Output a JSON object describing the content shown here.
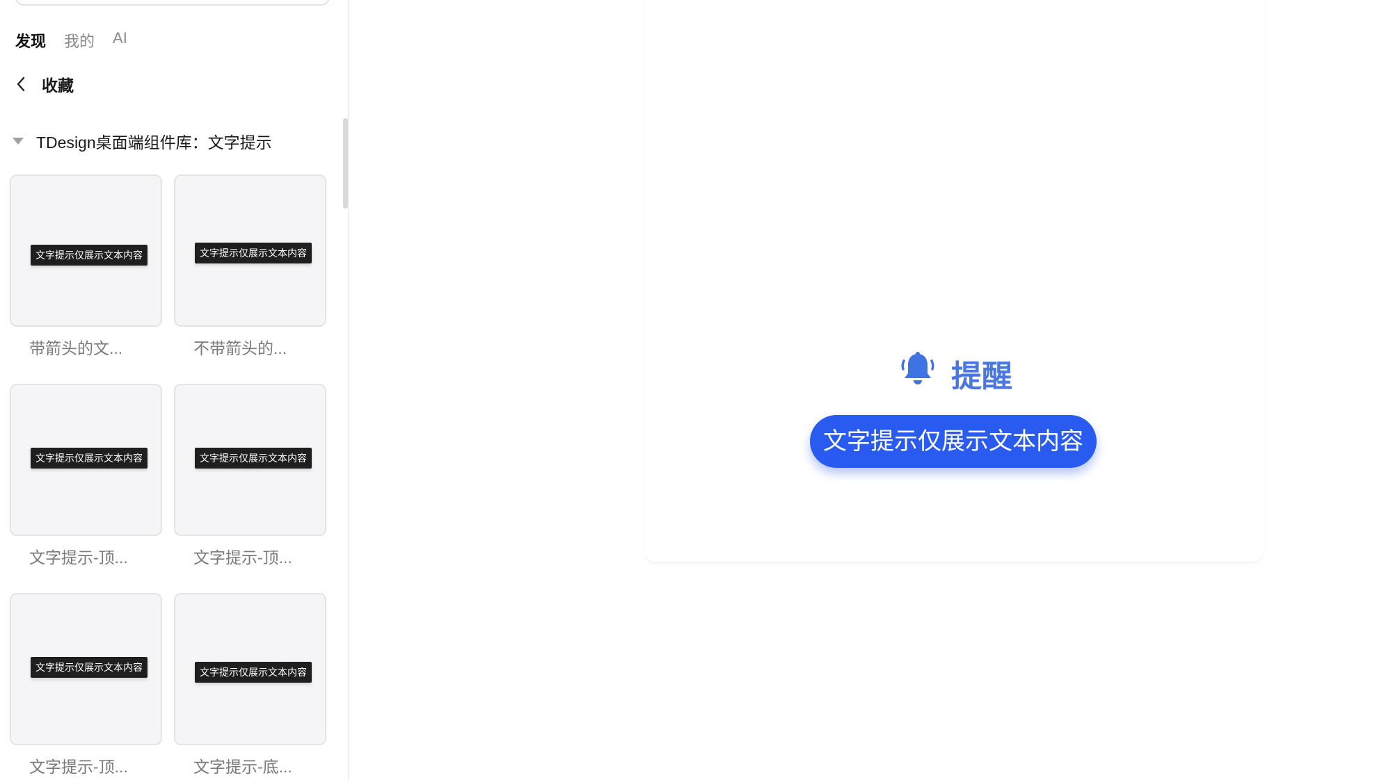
{
  "sidebar": {
    "tabs": [
      {
        "label": "发现",
        "active": true
      },
      {
        "label": "我的",
        "active": false
      },
      {
        "label": "AI",
        "active": false
      }
    ],
    "back_label": "收藏",
    "group_title": "TDesign桌面端组件库：文字提示",
    "cards": [
      {
        "label": "带箭头的文...",
        "tip": "文字提示仅展示文本内容",
        "arrow": "top-right"
      },
      {
        "label": "不带箭头的...",
        "tip": "文字提示仅展示文本内容",
        "arrow": "none"
      },
      {
        "label": "文字提示-顶...",
        "tip": "文字提示仅展示文本内容",
        "arrow": "bottom-right"
      },
      {
        "label": "文字提示-顶...",
        "tip": "文字提示仅展示文本内容",
        "arrow": "bottom-center"
      },
      {
        "label": "文字提示-顶...",
        "tip": "文字提示仅展示文本内容",
        "arrow": "bottom-left"
      },
      {
        "label": "文字提示-底...",
        "tip": "文字提示仅展示文本内容",
        "arrow": "top-right"
      }
    ]
  },
  "preview": {
    "title": "提醒",
    "icon": "bell-icon",
    "tip_text": "文字提示仅展示文本内容"
  },
  "colors": {
    "accent": "#2a5bf0",
    "title_blue": "#4a78e0",
    "tooltip_bg": "#1f1f1f"
  }
}
